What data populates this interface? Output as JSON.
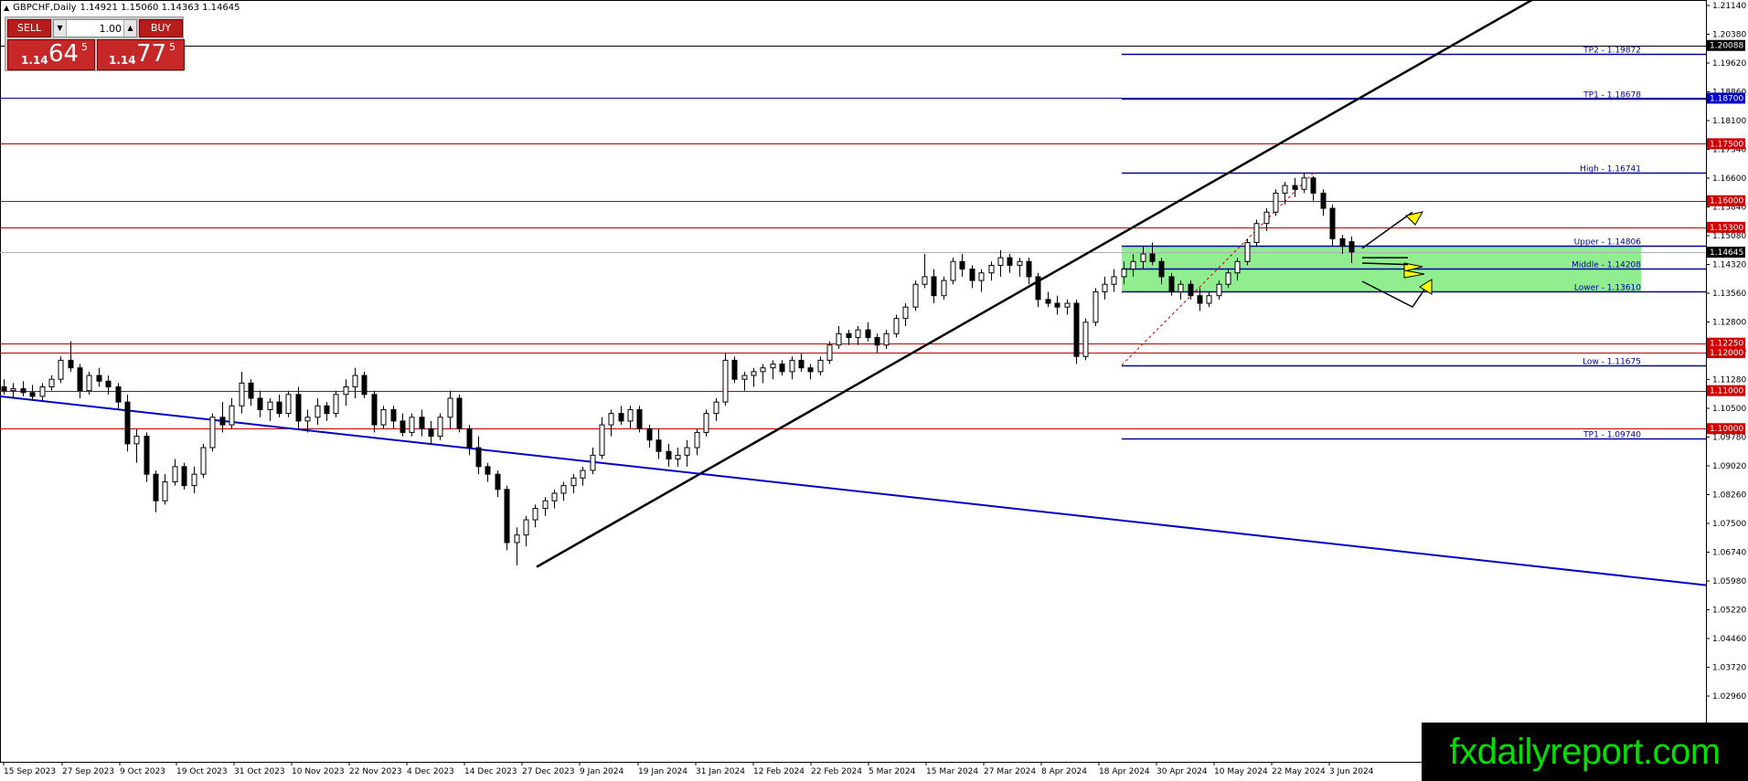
{
  "header": {
    "symbol": "GBPCHF,Daily",
    "ohlc": "1.14921 1.15060 1.14363 1.14645"
  },
  "trade_panel": {
    "sell_label": "SELL",
    "buy_label": "BUY",
    "lot": "1.00",
    "sell_price": {
      "prefix": "1.14",
      "big": "64",
      "sup": "5"
    },
    "buy_price": {
      "prefix": "1.14",
      "big": "77",
      "sup": "5"
    }
  },
  "watermark": "fxdailyreport.com",
  "colors": {
    "up_candle": "#ffffff",
    "down_candle": "#000000",
    "red_level": "#c00000",
    "blue_level": "#0000a0",
    "zone_fill": "#90ee90",
    "arrow_fill": "#ffff00",
    "price_tag_red": "#d00000",
    "price_tag_blue": "#0000c8"
  },
  "chart_data": {
    "type": "candlestick",
    "symbol": "GBPCHF",
    "timeframe": "Daily",
    "y_axis_ticks": [
      "1.21140",
      "1.20380",
      "1.19620",
      "1.18860",
      "1.18100",
      "1.17340",
      "1.16600",
      "1.15840",
      "1.15080",
      "1.14320",
      "1.13560",
      "1.12800",
      "1.12040",
      "1.11280",
      "1.10500",
      "1.09780",
      "1.09020",
      "1.08260",
      "1.07500",
      "1.06740",
      "1.05980",
      "1.05220",
      "1.04460",
      "1.03720",
      "1.02960"
    ],
    "x_axis_ticks": [
      "15 Sep 2023",
      "27 Sep 2023",
      "9 Oct 2023",
      "19 Oct 2023",
      "31 Oct 2023",
      "10 Nov 2023",
      "22 Nov 2023",
      "4 Dec 2023",
      "14 Dec 2023",
      "27 Dec 2023",
      "9 Jan 2024",
      "19 Jan 2024",
      "31 Jan 2024",
      "12 Feb 2024",
      "22 Feb 2024",
      "5 Mar 2024",
      "15 Mar 2024",
      "27 Mar 2024",
      "8 Apr 2024",
      "18 Apr 2024",
      "30 Apr 2024",
      "10 May 2024",
      "22 May 2024",
      "3 Jun 2024"
    ],
    "ylim": [
      1.0245,
      1.2148
    ],
    "horizontal_levels": [
      {
        "price": 1.20088,
        "tag": "1.20088",
        "color": "black",
        "tag_style": "black"
      },
      {
        "price": 1.187,
        "tag": "1.18700",
        "color": "blue",
        "tag_style": "blue"
      },
      {
        "price": 1.175,
        "tag": "1.17500",
        "color": "red",
        "tag_style": "red"
      },
      {
        "price": 1.16,
        "tag": "1.16000",
        "color": "red",
        "tag_style": "red"
      },
      {
        "price": 1.153,
        "tag": "1.15300",
        "color": "red",
        "tag_style": "red"
      },
      {
        "price": 1.14645,
        "tag": "1.14645",
        "color": "gray",
        "tag_style": "black"
      },
      {
        "price": 1.1225,
        "tag": "1.12250",
        "color": "red",
        "tag_style": "red"
      },
      {
        "price": 1.12,
        "tag": "1.12000",
        "color": "red",
        "tag_style": "red"
      },
      {
        "price": 1.11,
        "tag": "1.11000",
        "color": "red",
        "tag_style": "red"
      },
      {
        "price": 1.1,
        "tag": "1.10000",
        "color": "red",
        "tag_style": "red"
      }
    ],
    "fib_levels": [
      {
        "label": "TP2 - 1.19872",
        "price": 1.19872
      },
      {
        "label": "TP1 - 1.18678",
        "price": 1.18678
      },
      {
        "label": "High - 1.16741",
        "price": 1.16741
      },
      {
        "label": "Upper - 1.14806",
        "price": 1.14806
      },
      {
        "label": "Middle - 1.14208",
        "price": 1.14208
      },
      {
        "label": "Lower - 1.13610",
        "price": 1.1361
      },
      {
        "label": "Low - 1.11675",
        "price": 1.11675
      },
      {
        "label": "TP1 - 1.09740",
        "price": 1.0974
      }
    ],
    "zone": {
      "top": 1.14806,
      "bottom": 1.1361
    },
    "trendlines": [
      {
        "name": "ascending-trendline",
        "color": "black",
        "from": [
          "27 Dec 2023",
          1.0636
        ],
        "to": [
          "3 Jun 2024+",
          1.2155
        ]
      },
      {
        "name": "descending-trendline",
        "color": "blue",
        "from": [
          "15 Sep 2023",
          1.1085
        ],
        "to": [
          "end",
          1.0588
        ]
      }
    ],
    "candles": [
      [
        1.111,
        1.113,
        1.109,
        1.11
      ],
      [
        1.11,
        1.112,
        1.108,
        1.1105
      ],
      [
        1.1105,
        1.1125,
        1.1085,
        1.1095
      ],
      [
        1.1095,
        1.1115,
        1.1075,
        1.1085
      ],
      [
        1.1085,
        1.112,
        1.1075,
        1.111
      ],
      [
        1.111,
        1.114,
        1.11,
        1.113
      ],
      [
        1.113,
        1.119,
        1.112,
        1.118
      ],
      [
        1.118,
        1.123,
        1.115,
        1.116
      ],
      [
        1.116,
        1.117,
        1.108,
        1.11
      ],
      [
        1.11,
        1.115,
        1.109,
        1.114
      ],
      [
        1.114,
        1.116,
        1.111,
        1.1125
      ],
      [
        1.1125,
        1.114,
        1.109,
        1.111
      ],
      [
        1.111,
        1.112,
        1.105,
        1.107
      ],
      [
        1.107,
        1.109,
        1.094,
        1.096
      ],
      [
        1.096,
        1.1,
        1.091,
        1.098
      ],
      [
        1.098,
        1.099,
        1.086,
        1.088
      ],
      [
        1.088,
        1.089,
        1.078,
        1.081
      ],
      [
        1.081,
        1.088,
        1.08,
        1.086
      ],
      [
        1.086,
        1.092,
        1.085,
        1.09
      ],
      [
        1.09,
        1.091,
        1.084,
        1.085
      ],
      [
        1.085,
        1.09,
        1.083,
        1.088
      ],
      [
        1.088,
        1.096,
        1.087,
        1.095
      ],
      [
        1.095,
        1.104,
        1.094,
        1.103
      ],
      [
        1.103,
        1.107,
        1.099,
        1.101
      ],
      [
        1.101,
        1.108,
        1.1,
        1.106
      ],
      [
        1.106,
        1.115,
        1.104,
        1.112
      ],
      [
        1.112,
        1.113,
        1.106,
        1.108
      ],
      [
        1.108,
        1.11,
        1.103,
        1.105
      ],
      [
        1.105,
        1.108,
        1.102,
        1.107
      ],
      [
        1.107,
        1.109,
        1.103,
        1.104
      ],
      [
        1.104,
        1.11,
        1.103,
        1.109
      ],
      [
        1.109,
        1.111,
        1.1,
        1.102
      ],
      [
        1.102,
        1.105,
        1.099,
        1.103
      ],
      [
        1.103,
        1.108,
        1.101,
        1.106
      ],
      [
        1.106,
        1.107,
        1.102,
        1.104
      ],
      [
        1.104,
        1.11,
        1.103,
        1.109
      ],
      [
        1.109,
        1.113,
        1.106,
        1.111
      ],
      [
        1.111,
        1.116,
        1.108,
        1.114
      ],
      [
        1.114,
        1.115,
        1.108,
        1.109
      ],
      [
        1.109,
        1.11,
        1.099,
        1.101
      ],
      [
        1.101,
        1.106,
        1.1,
        1.105
      ],
      [
        1.105,
        1.106,
        1.1,
        1.102
      ],
      [
        1.102,
        1.104,
        1.098,
        1.099
      ],
      [
        1.099,
        1.104,
        1.098,
        1.103
      ],
      [
        1.103,
        1.105,
        1.098,
        1.1
      ],
      [
        1.1,
        1.102,
        1.096,
        1.098
      ],
      [
        1.098,
        1.104,
        1.097,
        1.103
      ],
      [
        1.103,
        1.11,
        1.1,
        1.108
      ],
      [
        1.108,
        1.109,
        1.099,
        1.1
      ],
      [
        1.1,
        1.101,
        1.093,
        1.095
      ],
      [
        1.095,
        1.098,
        1.088,
        1.09
      ],
      [
        1.09,
        1.091,
        1.086,
        1.088
      ],
      [
        1.088,
        1.089,
        1.082,
        1.084
      ],
      [
        1.084,
        1.085,
        1.068,
        1.07
      ],
      [
        1.07,
        1.074,
        1.064,
        1.072
      ],
      [
        1.072,
        1.077,
        1.069,
        1.076
      ],
      [
        1.076,
        1.08,
        1.074,
        1.079
      ],
      [
        1.079,
        1.082,
        1.077,
        1.081
      ],
      [
        1.081,
        1.084,
        1.079,
        1.083
      ],
      [
        1.083,
        1.086,
        1.081,
        1.085
      ],
      [
        1.085,
        1.088,
        1.083,
        1.087
      ],
      [
        1.087,
        1.09,
        1.085,
        1.089
      ],
      [
        1.089,
        1.095,
        1.088,
        1.093
      ],
      [
        1.093,
        1.103,
        1.092,
        1.101
      ],
      [
        1.101,
        1.105,
        1.098,
        1.104
      ],
      [
        1.104,
        1.106,
        1.101,
        1.102
      ],
      [
        1.102,
        1.106,
        1.1,
        1.105
      ],
      [
        1.105,
        1.106,
        1.099,
        1.1
      ],
      [
        1.1,
        1.101,
        1.095,
        1.097
      ],
      [
        1.097,
        1.1,
        1.092,
        1.094
      ],
      [
        1.094,
        1.096,
        1.09,
        1.092
      ],
      [
        1.092,
        1.095,
        1.09,
        1.093
      ],
      [
        1.093,
        1.097,
        1.09,
        1.095
      ],
      [
        1.095,
        1.1,
        1.093,
        1.099
      ],
      [
        1.099,
        1.105,
        1.098,
        1.104
      ],
      [
        1.104,
        1.108,
        1.102,
        1.107
      ],
      [
        1.107,
        1.12,
        1.106,
        1.118
      ],
      [
        1.118,
        1.119,
        1.112,
        1.113
      ],
      [
        1.113,
        1.115,
        1.11,
        1.114
      ],
      [
        1.114,
        1.116,
        1.111,
        1.115
      ],
      [
        1.115,
        1.117,
        1.112,
        1.116
      ],
      [
        1.116,
        1.118,
        1.113,
        1.117
      ],
      [
        1.117,
        1.118,
        1.114,
        1.115
      ],
      [
        1.115,
        1.119,
        1.113,
        1.118
      ],
      [
        1.118,
        1.12,
        1.115,
        1.116
      ],
      [
        1.116,
        1.117,
        1.113,
        1.115
      ],
      [
        1.115,
        1.119,
        1.114,
        1.118
      ],
      [
        1.118,
        1.123,
        1.117,
        1.122
      ],
      [
        1.122,
        1.127,
        1.121,
        1.125
      ],
      [
        1.125,
        1.126,
        1.122,
        1.124
      ],
      [
        1.124,
        1.127,
        1.122,
        1.126
      ],
      [
        1.126,
        1.128,
        1.123,
        1.124
      ],
      [
        1.124,
        1.125,
        1.12,
        1.122
      ],
      [
        1.122,
        1.126,
        1.121,
        1.125
      ],
      [
        1.125,
        1.13,
        1.124,
        1.129
      ],
      [
        1.129,
        1.133,
        1.127,
        1.132
      ],
      [
        1.132,
        1.139,
        1.131,
        1.138
      ],
      [
        1.138,
        1.146,
        1.137,
        1.14
      ],
      [
        1.14,
        1.142,
        1.133,
        1.135
      ],
      [
        1.135,
        1.14,
        1.134,
        1.139
      ],
      [
        1.139,
        1.145,
        1.138,
        1.144
      ],
      [
        1.144,
        1.146,
        1.14,
        1.142
      ],
      [
        1.142,
        1.143,
        1.137,
        1.139
      ],
      [
        1.139,
        1.142,
        1.136,
        1.141
      ],
      [
        1.141,
        1.144,
        1.139,
        1.143
      ],
      [
        1.143,
        1.147,
        1.14,
        1.145
      ],
      [
        1.145,
        1.146,
        1.141,
        1.143
      ],
      [
        1.143,
        1.145,
        1.14,
        1.144
      ],
      [
        1.144,
        1.145,
        1.138,
        1.14
      ],
      [
        1.14,
        1.141,
        1.132,
        1.134
      ],
      [
        1.134,
        1.136,
        1.132,
        1.133
      ],
      [
        1.133,
        1.135,
        1.13,
        1.132
      ],
      [
        1.132,
        1.134,
        1.13,
        1.133
      ],
      [
        1.133,
        1.134,
        1.117,
        1.119
      ],
      [
        1.119,
        1.129,
        1.118,
        1.128
      ],
      [
        1.128,
        1.137,
        1.127,
        1.136
      ],
      [
        1.136,
        1.14,
        1.134,
        1.138
      ],
      [
        1.138,
        1.142,
        1.136,
        1.14
      ],
      [
        1.14,
        1.144,
        1.138,
        1.142
      ],
      [
        1.142,
        1.146,
        1.14,
        1.144
      ],
      [
        1.144,
        1.148,
        1.142,
        1.146
      ],
      [
        1.146,
        1.149,
        1.143,
        1.144
      ],
      [
        1.144,
        1.145,
        1.138,
        1.14
      ],
      [
        1.14,
        1.141,
        1.135,
        1.136
      ],
      [
        1.136,
        1.139,
        1.134,
        1.138
      ],
      [
        1.138,
        1.139,
        1.134,
        1.135
      ],
      [
        1.135,
        1.137,
        1.131,
        1.133
      ],
      [
        1.133,
        1.136,
        1.132,
        1.135
      ],
      [
        1.135,
        1.139,
        1.134,
        1.138
      ],
      [
        1.138,
        1.142,
        1.137,
        1.141
      ],
      [
        1.141,
        1.145,
        1.139,
        1.144
      ],
      [
        1.144,
        1.15,
        1.143,
        1.149
      ],
      [
        1.149,
        1.155,
        1.148,
        1.154
      ],
      [
        1.154,
        1.158,
        1.152,
        1.157
      ],
      [
        1.157,
        1.163,
        1.156,
        1.162
      ],
      [
        1.162,
        1.165,
        1.159,
        1.164
      ],
      [
        1.164,
        1.166,
        1.161,
        1.163
      ],
      [
        1.163,
        1.1674,
        1.162,
        1.166
      ],
      [
        1.166,
        1.1665,
        1.16,
        1.162
      ],
      [
        1.162,
        1.163,
        1.156,
        1.158
      ],
      [
        1.158,
        1.159,
        1.148,
        1.15
      ],
      [
        1.15,
        1.151,
        1.146,
        1.148
      ],
      [
        1.1492,
        1.1506,
        1.1436,
        1.1465
      ]
    ],
    "annotations": [
      {
        "type": "arrow",
        "color": "yellow",
        "direction": "up"
      },
      {
        "type": "arrow",
        "color": "yellow",
        "direction": "right"
      },
      {
        "type": "arrow",
        "color": "yellow",
        "direction": "right"
      },
      {
        "type": "arrow",
        "color": "yellow",
        "direction": "down-then-up"
      }
    ],
    "legend": "none",
    "grid": false
  }
}
